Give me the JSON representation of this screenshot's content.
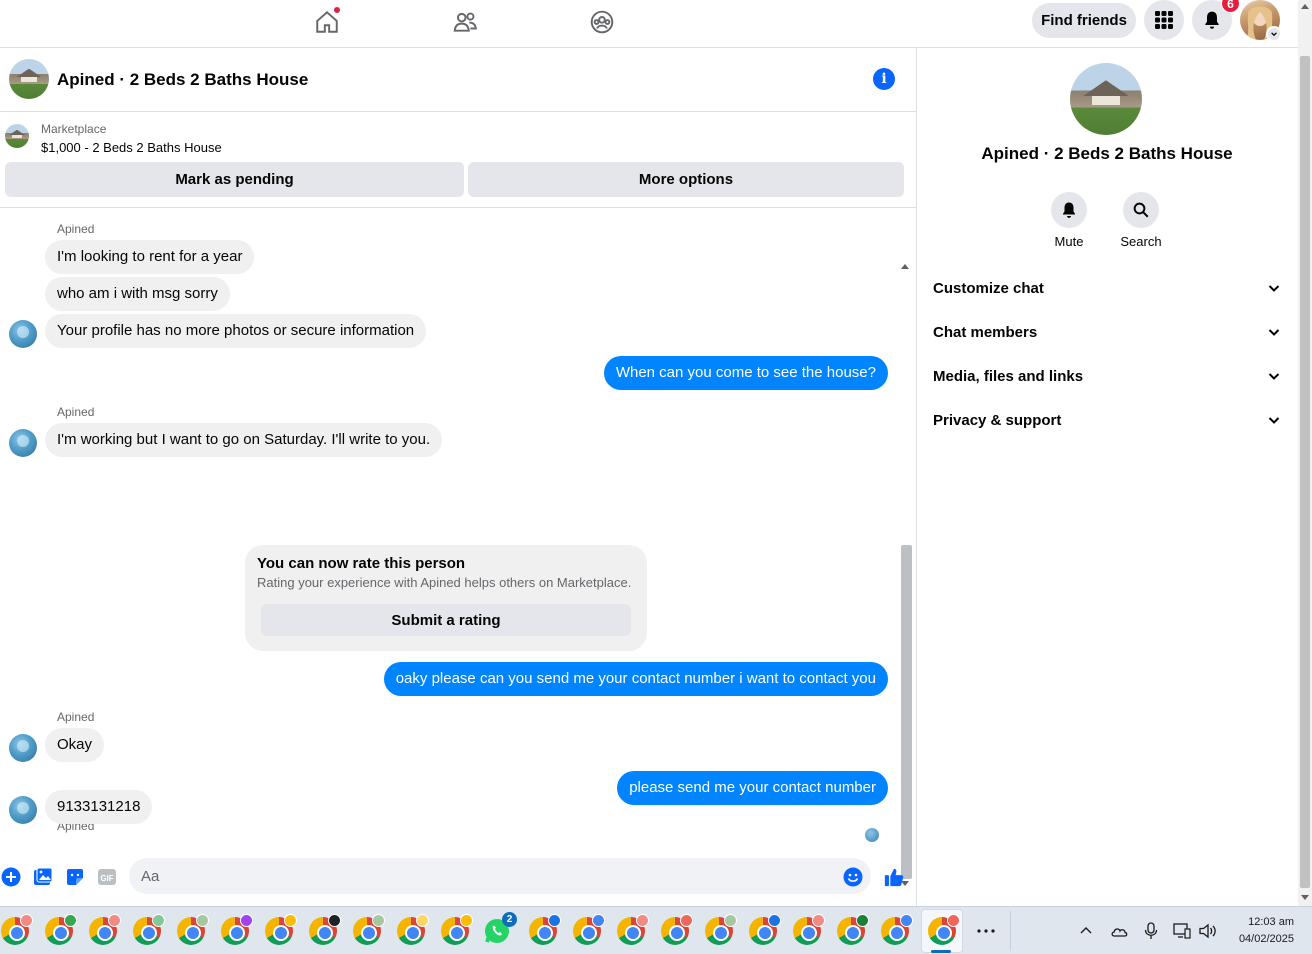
{
  "topbar": {
    "find_friends_label": "Find friends",
    "notifications_count": "6"
  },
  "chat": {
    "title": "Apined · 2 Beds 2 Baths House",
    "marketplace_label": "Marketplace",
    "marketplace_item": "$1,000 - 2 Beds 2 Baths House",
    "mark_pending_label": "Mark as pending",
    "more_options_label": "More options",
    "messages": [
      {
        "from": "Apined",
        "sender_label": "Apined",
        "text": "I'm looking to rent for a year"
      },
      {
        "from": "Apined",
        "text": "who am i with msg sorry"
      },
      {
        "from": "Apined",
        "text": "Your profile has no more photos or secure information"
      },
      {
        "from": "me",
        "text": "When can you come to see the house?"
      },
      {
        "from": "Apined",
        "sender_label": "Apined",
        "text": "I'm working but I want to go on Saturday. I'll write to you."
      },
      {
        "from": "me",
        "text": "oaky please can you send me your contact number i want to contact you"
      },
      {
        "from": "Apined",
        "sender_label": "Apined",
        "text": "Okay"
      },
      {
        "from": "me",
        "text": "please send me your contact number"
      },
      {
        "from": "Apined",
        "sender_label": "Apined",
        "text": "9133131218"
      }
    ],
    "rating_card": {
      "title": "You can now rate this person",
      "subtitle": "Rating your experience with Apined helps others on Marketplace.",
      "button_label": "Submit a rating"
    },
    "composer_placeholder": "Aa"
  },
  "sidebar": {
    "name": "Apined · 2 Beds 2 Baths House",
    "actions": [
      {
        "label": "Mute",
        "icon": "bell-icon"
      },
      {
        "label": "Search",
        "icon": "search-icon"
      }
    ],
    "sections": [
      {
        "label": "Customize chat"
      },
      {
        "label": "Chat members"
      },
      {
        "label": "Media, files and links"
      },
      {
        "label": "Privacy & support"
      }
    ]
  },
  "taskbar": {
    "whatsapp_badge": "2",
    "time": "12:03 am",
    "date": "04/02/2025"
  },
  "colors": {
    "accent": "#0866ff",
    "outgoing_bubble": "#0084ff",
    "incoming_bubble": "#f0f0f0",
    "badge": "#e41e3f"
  }
}
